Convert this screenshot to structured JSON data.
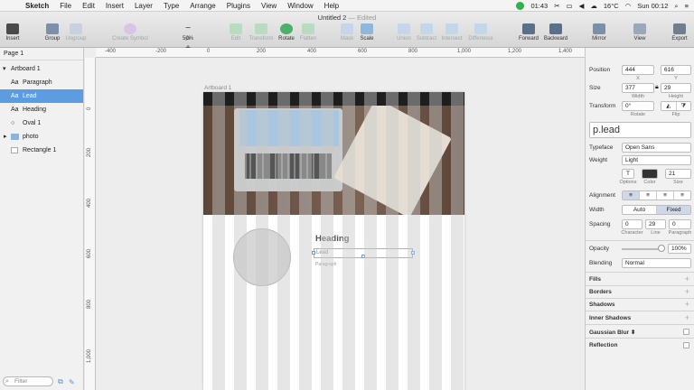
{
  "menubar": {
    "apple": "",
    "items": [
      "Sketch",
      "File",
      "Edit",
      "Insert",
      "Layer",
      "Type",
      "Arrange",
      "Plugins",
      "View",
      "Window",
      "Help"
    ],
    "time_left": "01:43",
    "temperature": "16°C",
    "clock": "Sun 00:12"
  },
  "document": {
    "title": "Untitled 2",
    "status": "— Edited"
  },
  "toolbar": {
    "insert": "Insert",
    "group": "Group",
    "ungroup": "Ungroup",
    "create_symbol": "Create Symbol",
    "zoom": "50%",
    "edit": "Edit",
    "transform": "Transform",
    "rotate": "Rotate",
    "flatten": "Flatten",
    "mask": "Mask",
    "scale": "Scale",
    "union": "Union",
    "subtract": "Subtract",
    "intersect": "Intersect",
    "difference": "Difference",
    "forward": "Forward",
    "backward": "Backward",
    "mirror": "Mirror",
    "view": "View",
    "export": "Export"
  },
  "layers": {
    "page": "Page 1",
    "artboard": "Artboard 1",
    "items": [
      {
        "label": "Paragraph",
        "icon": "Aa"
      },
      {
        "label": "Lead",
        "icon": "Aa"
      },
      {
        "label": "Heading",
        "icon": "Aa"
      },
      {
        "label": "Oval 1",
        "icon": "○"
      },
      {
        "label": "photo",
        "icon": "▸"
      },
      {
        "label": "Rectangle 1",
        "icon": ""
      }
    ],
    "filter_placeholder": "Filter"
  },
  "rulers": {
    "h": [
      "-400",
      "-200",
      "0",
      "200",
      "400",
      "600",
      "800",
      "1,000",
      "1,200",
      "1,400"
    ],
    "v": [
      "0",
      "200",
      "400",
      "600",
      "800",
      "1,000"
    ]
  },
  "artboard": {
    "label": "Artboard 1",
    "heading": "Heading",
    "lead": "Lead",
    "paragraph": "Paragraph"
  },
  "inspector": {
    "position_label": "Position",
    "x": "444",
    "y": "616",
    "x_label": "X",
    "y_label": "Y",
    "size_label": "Size",
    "width": "377",
    "height": "29",
    "width_label": "Width",
    "height_label": "Height",
    "transform_label": "Transform",
    "rotate": "0°",
    "rotate_label": "Rotate",
    "flip_label": "Flip",
    "style_name": "p.lead",
    "typeface_label": "Typeface",
    "typeface": "Open Sans",
    "weight_label": "Weight",
    "weight": "Light",
    "options_label": "Options",
    "color_label": "Color",
    "font_size": "21",
    "size_small_label": "Size",
    "alignment_label": "Alignment",
    "width_mode_label": "Width",
    "auto": "Auto",
    "fixed": "Fixed",
    "spacing_label": "Spacing",
    "character": "0",
    "line": "29",
    "paragraph_spacing": "0",
    "character_label": "Character",
    "line_label": "Line",
    "paragraph_label": "Paragraph",
    "opacity_label": "Opacity",
    "opacity": "100%",
    "blending_label": "Blending",
    "blending": "Normal",
    "fills": "Fills",
    "borders": "Borders",
    "shadows": "Shadows",
    "inner_shadows": "Inner Shadows",
    "gaussian_blur": "Gaussian Blur ⬍",
    "reflection": "Reflection"
  },
  "colors": {
    "selection": "#5b9de0",
    "text_color": "#222222"
  }
}
